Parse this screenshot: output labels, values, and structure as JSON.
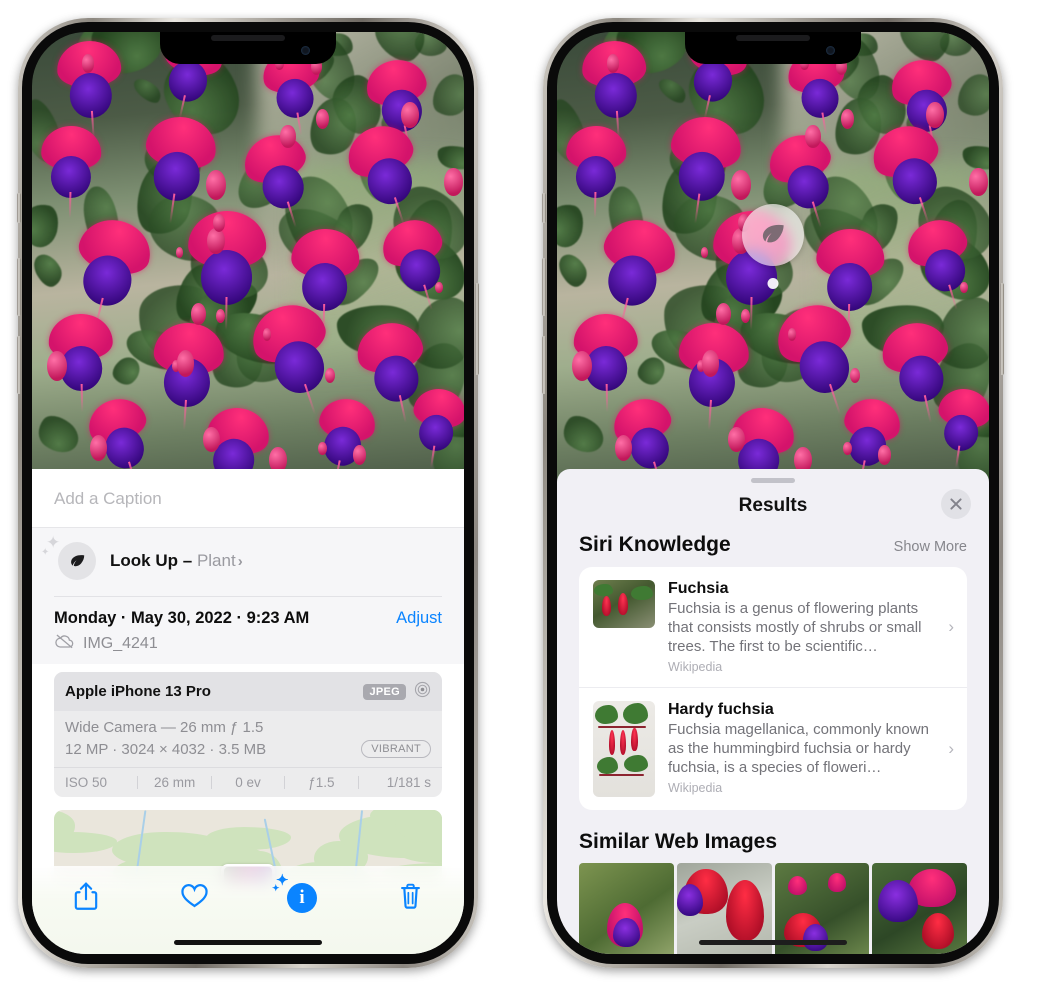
{
  "left_phone": {
    "photo": {
      "alt_name": "fuchsia-flowers-photo"
    },
    "caption_placeholder": "Add a Caption",
    "caption_value": "",
    "lookup": {
      "icon": "leaf-icon",
      "label": "Look Up",
      "dash": "–",
      "subject": "Plant",
      "chevron": "›"
    },
    "meta": {
      "datetime": "Monday · May 30, 2022 · 9:23 AM",
      "adjust_label": "Adjust",
      "cloud_icon": "cloud-slash-icon",
      "filename": "IMG_4241"
    },
    "exif": {
      "device": "Apple iPhone 13 Pro",
      "format_badge": "JPEG",
      "aperture_icon": "aperture-icon",
      "lens_line": "Wide Camera — 26 mm ƒ 1.5",
      "size_line": "12 MP · 3024 × 4032 · 3.5 MB",
      "style_badge": "VIBRANT",
      "stats": [
        "ISO 50",
        "26 mm",
        "0 ev",
        "ƒ1.5",
        "1/181 s"
      ]
    },
    "toolbar": [
      {
        "name": "share-button",
        "icon": "share-icon"
      },
      {
        "name": "favorite-button",
        "icon": "heart-icon"
      },
      {
        "name": "info-button",
        "icon": "info-sparkle-icon",
        "active": true
      },
      {
        "name": "delete-button",
        "icon": "trash-icon"
      }
    ]
  },
  "right_phone": {
    "visual_lookup_badge": {
      "icon": "leaf-icon"
    },
    "sheet": {
      "grabber": "drag-handle",
      "title": "Results",
      "close_icon": "close-icon"
    },
    "siri_knowledge": {
      "title": "Siri Knowledge",
      "show_more": "Show More",
      "items": [
        {
          "title": "Fuchsia",
          "description": "Fuchsia is a genus of flowering plants that consists mostly of shrubs or small trees. The first to be scientific…",
          "source": "Wikipedia",
          "chevron": "›"
        },
        {
          "title": "Hardy fuchsia",
          "description": "Fuchsia magellanica, commonly known as the hummingbird fuchsia or hardy fuchsia, is a species of floweri…",
          "source": "Wikipedia",
          "chevron": "›"
        }
      ]
    },
    "similar_web_images": {
      "title": "Similar Web Images",
      "thumbnails": [
        "web-image-1",
        "web-image-2",
        "web-image-3",
        "web-image-4"
      ]
    }
  },
  "colors": {
    "accent_blue": "#0a84ff",
    "sheet_bg": "#f1f0f5",
    "card_bg": "#ffffff",
    "secondary_text": "#8e8e93"
  }
}
